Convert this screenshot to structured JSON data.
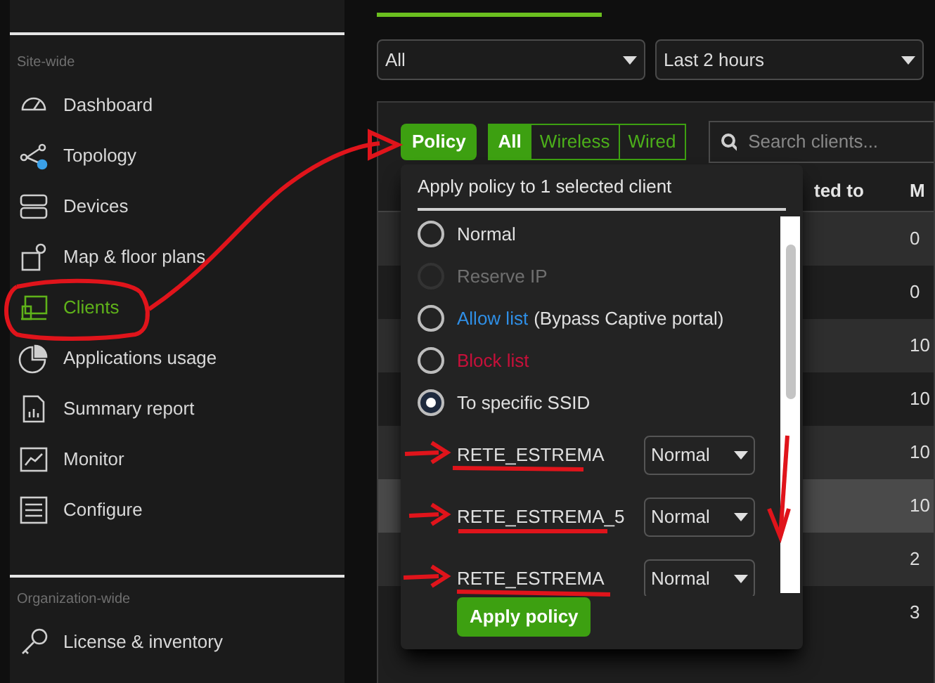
{
  "sidebar": {
    "sections": [
      {
        "heading": "Site-wide",
        "items": [
          {
            "label": "Dashboard",
            "selected": false
          },
          {
            "label": "Topology",
            "selected": false
          },
          {
            "label": "Devices",
            "selected": false
          },
          {
            "label": "Map & floor plans",
            "selected": false
          },
          {
            "label": "Clients",
            "selected": true
          },
          {
            "label": "Applications usage",
            "selected": false
          },
          {
            "label": "Summary report",
            "selected": false
          },
          {
            "label": "Monitor",
            "selected": false
          },
          {
            "label": "Configure",
            "selected": false
          }
        ]
      },
      {
        "heading": "Organization-wide",
        "items": [
          {
            "label": "License & inventory",
            "selected": false
          }
        ]
      }
    ]
  },
  "filters": [
    {
      "value": "All"
    },
    {
      "value": "Last 2 hours"
    }
  ],
  "toolbar": {
    "policy_button": "Policy",
    "segments": [
      {
        "label": "All",
        "selected": true
      },
      {
        "label": "Wireless",
        "selected": false
      },
      {
        "label": "Wired",
        "selected": false
      }
    ],
    "search": {
      "placeholder": "Search clients..."
    }
  },
  "table": {
    "columns": [
      {
        "label": "ted to"
      },
      {
        "label": "M"
      }
    ],
    "rows": [
      {
        "cells": [
          "0"
        ],
        "selected": false
      },
      {
        "cells": [
          "0"
        ],
        "selected": false
      },
      {
        "cells": [
          "10"
        ],
        "selected": false
      },
      {
        "cells": [
          "10"
        ],
        "selected": false
      },
      {
        "cells": [
          "10"
        ],
        "selected": false
      },
      {
        "cells": [
          "10"
        ],
        "selected": true
      },
      {
        "cells": [
          "2"
        ],
        "selected": false
      },
      {
        "cells": [
          "3"
        ],
        "selected": false
      }
    ]
  },
  "policy_popup": {
    "title": "Apply policy to 1 selected client",
    "options": [
      {
        "kind": "plain",
        "label": "Normal",
        "selected": false,
        "disabled": false
      },
      {
        "kind": "plain",
        "label": "Reserve IP",
        "selected": false,
        "disabled": true
      },
      {
        "kind": "allow",
        "label": "Allow list",
        "note": "(Bypass Captive portal)",
        "selected": false,
        "disabled": false
      },
      {
        "kind": "block",
        "label": "Block list",
        "selected": false,
        "disabled": false
      },
      {
        "kind": "plain",
        "label": "To specific SSID",
        "selected": true,
        "disabled": false
      }
    ],
    "ssids": [
      {
        "name": "RETE_ESTREMA",
        "policy": "Normal"
      },
      {
        "name": "RETE_ESTREMA_5",
        "policy": "Normal"
      },
      {
        "name": "RETE_ESTREMA",
        "policy": "Normal"
      }
    ],
    "apply_button": "Apply policy"
  }
}
